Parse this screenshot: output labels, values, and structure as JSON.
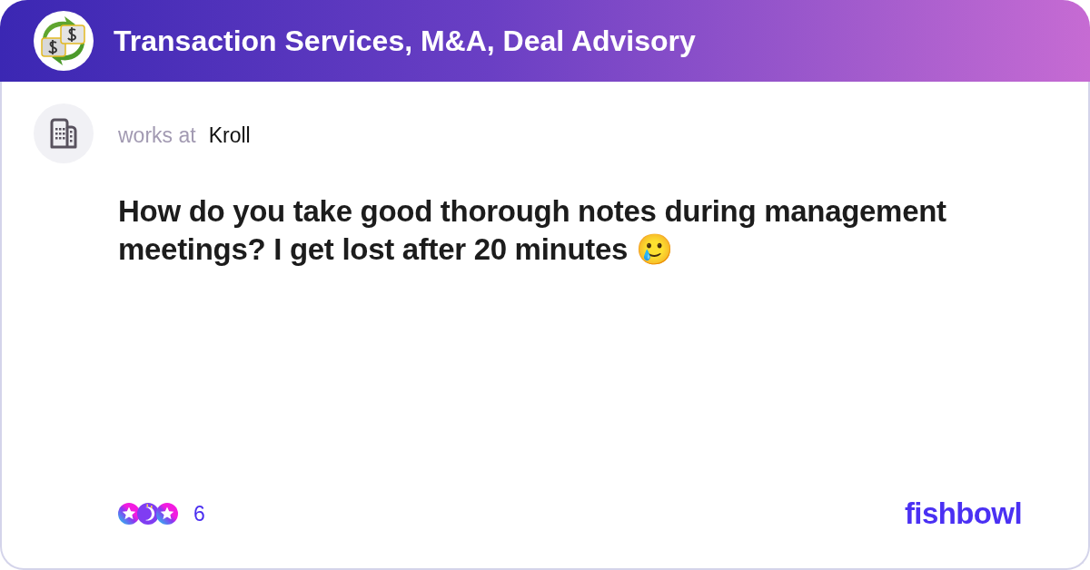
{
  "group": {
    "name": "Transaction Services, M&A, Deal Advisory"
  },
  "author": {
    "prefix": "works at",
    "company": "Kroll"
  },
  "post": {
    "text": "How do you take good thorough notes during management meetings? I get lost after 20 minutes 🥲"
  },
  "reactions": {
    "items": [
      {
        "kind": "star"
      },
      {
        "kind": "moon"
      },
      {
        "kind": "star"
      }
    ],
    "count": "6"
  },
  "brand": {
    "logo": "fishbowl"
  }
}
